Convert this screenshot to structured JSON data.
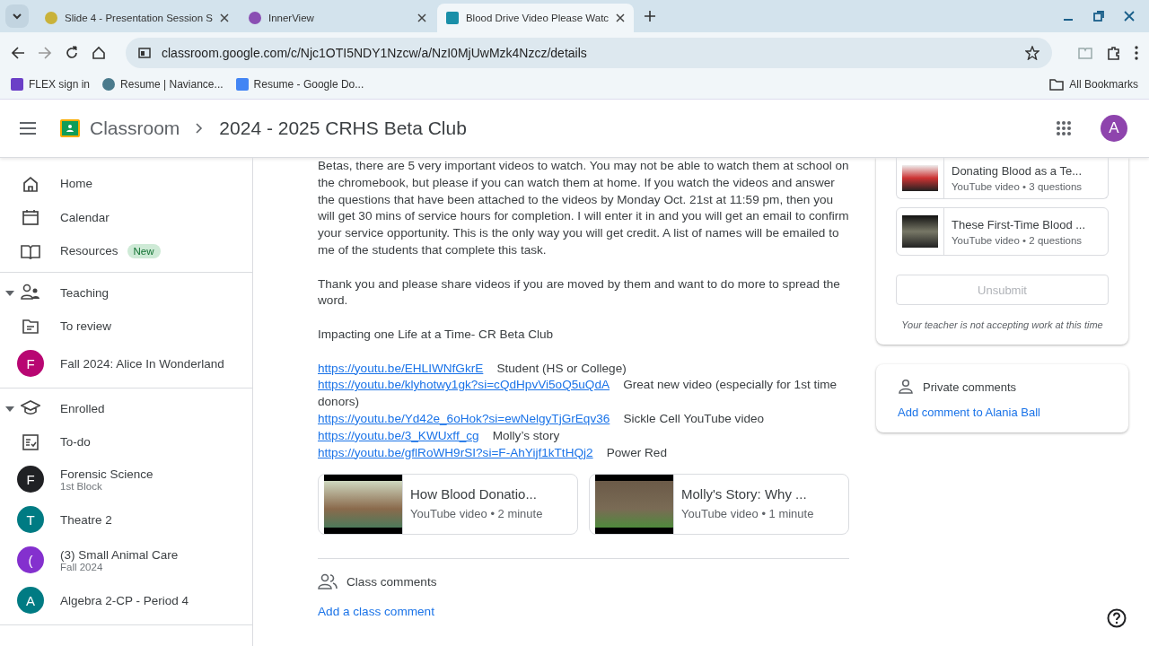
{
  "browser": {
    "tabs": [
      {
        "title": "Slide 4 - Presentation Session S",
        "selected": false
      },
      {
        "title": "InnerView",
        "selected": false
      },
      {
        "title": "Blood Drive Video Please Watc",
        "selected": true
      }
    ],
    "url": "classroom.google.com/c/Njc1OTI5NDY1Nzcw/a/NzI0MjUwMzk4Nzcz/details",
    "bookmarks": [
      {
        "label": "FLEX sign in"
      },
      {
        "label": "Resume | Naviance..."
      },
      {
        "label": "Resume - Google Do..."
      }
    ],
    "all_bookmarks": "All Bookmarks"
  },
  "header": {
    "app": "Classroom",
    "breadcrumb": "2024 - 2025 CRHS Beta Club",
    "avatar": "A"
  },
  "sidebar": {
    "groups": [
      {
        "items": [
          {
            "kind": "nav",
            "label": "Home"
          },
          {
            "kind": "nav",
            "label": "Calendar"
          },
          {
            "kind": "nav",
            "label": "Resources",
            "badge": "New"
          }
        ]
      },
      {
        "header": {
          "label": "Teaching",
          "expanded": true
        },
        "items": [
          {
            "kind": "nav",
            "label": "To review"
          },
          {
            "kind": "class",
            "letter": "F",
            "label": "Fall 2024: Alice In Wonderland",
            "color": "#b80672"
          }
        ]
      },
      {
        "header": {
          "label": "Enrolled",
          "expanded": true
        },
        "items": [
          {
            "kind": "nav",
            "label": "To-do"
          },
          {
            "kind": "class",
            "letter": "F",
            "label": "Forensic Science",
            "sub": "1st Block",
            "color": "#202124"
          },
          {
            "kind": "class",
            "letter": "T",
            "label": "Theatre 2",
            "color": "#007b83"
          },
          {
            "kind": "class",
            "letter": "(",
            "label": "(3) Small Animal Care",
            "sub": "Fall 2024",
            "color": "#8430ce"
          },
          {
            "kind": "class",
            "letter": "A",
            "label": "Algebra 2-CP - Period 4",
            "color": "#007b83"
          }
        ]
      }
    ]
  },
  "post": {
    "paragraphs": [
      "Betas, there are 5 very important videos to watch. You may not be able to watch them at school on the chromebook, but please if you can watch them at home. If you watch the videos and answer the questions that have been attached to the videos by Monday Oct. 21st at 11:59 pm, then you will get 30 mins of service hours for completion. I will enter it in and you will get an email to confirm your service opportunity. This is the only way you will get credit. A list of names will be emailed to me of the students that complete this task.",
      "Thank you and please share videos if you are moved by them and want to do more to spread the word.",
      "Impacting one Life at a Time- CR Beta Club"
    ],
    "links": [
      {
        "url": "https://youtu.be/EHLIWNfGkrE",
        "note": "Student (HS or College)"
      },
      {
        "url": "https://youtu.be/klyhotwy1gk?si=cQdHpvVi5oQ5uQdA",
        "note": "Great new video (especially for 1st time donors)"
      },
      {
        "url": "https://youtu.be/Yd42e_6oHok?si=ewNelgyTjGrEqv36",
        "note": "Sickle Cell YouTube video"
      },
      {
        "url": "https://youtu.be/3_KWUxff_cg",
        "note": "Molly’s story"
      },
      {
        "url": "https://youtu.be/gflRoWH9rSI?si=F-AhYijf1kTtHQj2",
        "note": "Power Red"
      }
    ],
    "videos": [
      {
        "title": "How Blood Donatio...",
        "meta": "YouTube video • 2 minute"
      },
      {
        "title": "Molly's Story: Why ...",
        "meta": "YouTube video • 1 minute"
      }
    ],
    "class_comments": "Class comments",
    "add_comment": "Add a class comment"
  },
  "work": {
    "attachments": [
      {
        "title": "Donating Blood as a Te...",
        "meta": "YouTube video • 3 questions"
      },
      {
        "title": "These First-Time Blood ...",
        "meta": "YouTube video • 2 questions"
      }
    ],
    "unsubmit": {
      "label": "Unsubmit",
      "disabled": true
    },
    "note": "Your teacher is not accepting work at this time"
  },
  "private": {
    "heading": "Private comments",
    "add": "Add comment to Alania Ball"
  }
}
